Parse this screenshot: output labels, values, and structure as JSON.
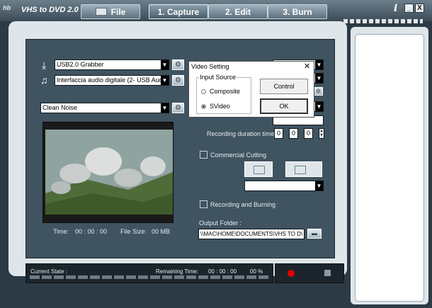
{
  "app": {
    "logo": "hb",
    "title": "VHS to DVD 2.0"
  },
  "tabs": [
    {
      "label": "File"
    },
    {
      "label": "1. Capture"
    },
    {
      "label": "2. Edit"
    },
    {
      "label": "3. Burn"
    }
  ],
  "window": {
    "help": "i",
    "minimize": "_",
    "close": "X"
  },
  "capture": {
    "video_device": "USB2.0 Grabber",
    "audio_device": "Interfaccia audio digitale (2- USB Audio Inter",
    "filter": "Clean Noise",
    "time_label": "Time:",
    "time_value": "00 : 00 : 00",
    "filesize_label": "File Size:",
    "filesize_value": "00 MB"
  },
  "settings": {
    "recording_duration_label": "Recording duration time :",
    "duration_digits": [
      "0",
      "0",
      "0"
    ],
    "commercial_cutting_label": "Commercial Cutting",
    "recording_burning_label": "Recording and Burning",
    "output_folder_label": "Output Folder :",
    "output_folder_path": "\\\\MAC\\HOME\\DOCUMENTS\\VHS TO D\\"
  },
  "status": {
    "current_state_label": "Current State :",
    "remaining_time_label": "Remaining Time:",
    "remaining_time_value": "00 : 00 : 00",
    "percent": "00 %"
  },
  "dialog": {
    "title": "Video Setting",
    "close": "✕",
    "group_label": "Input Source",
    "option_composite": "Composite",
    "option_svideo": "SVideo",
    "selected": "SVideo",
    "control_button": "Control",
    "ok_button": "OK"
  },
  "colors": {
    "record": "#e00000",
    "panel": "#3f5360"
  }
}
